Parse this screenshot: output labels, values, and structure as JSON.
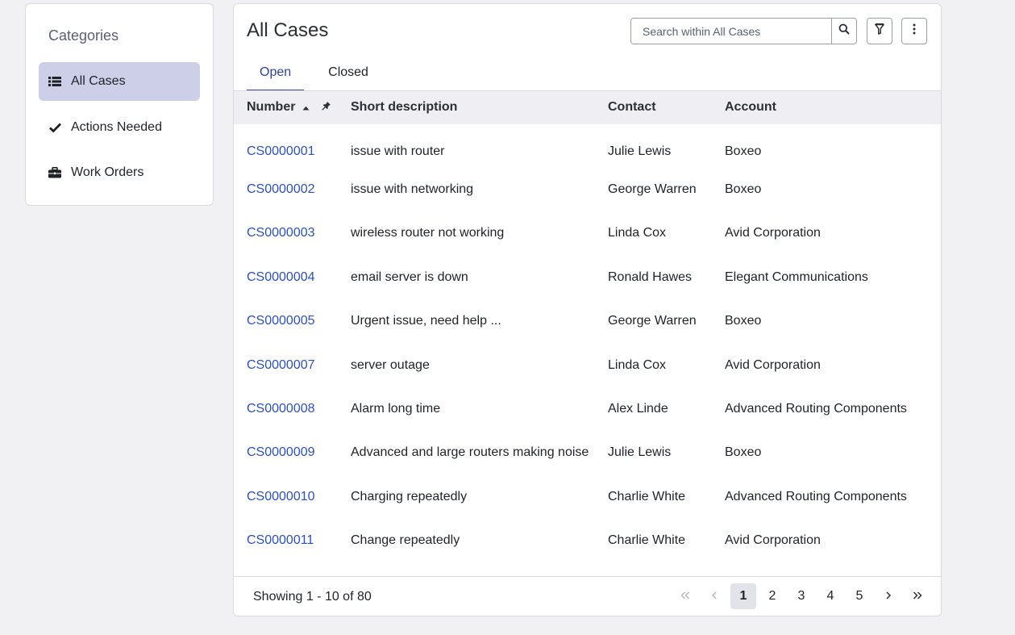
{
  "sidebar": {
    "title": "Categories",
    "items": [
      {
        "label": "All Cases",
        "icon": "list-icon",
        "active": true
      },
      {
        "label": "Actions Needed",
        "icon": "checkmark-icon",
        "active": false
      },
      {
        "label": "Work Orders",
        "icon": "briefcase-icon",
        "active": false
      }
    ]
  },
  "main": {
    "title": "All Cases",
    "search_placeholder": "Search within All Cases",
    "tabs": [
      {
        "label": "Open",
        "active": true
      },
      {
        "label": "Closed",
        "active": false
      }
    ],
    "columns": {
      "number": "Number",
      "short_description": "Short description",
      "contact": "Contact",
      "account": "Account"
    },
    "sort": {
      "column": "Number",
      "direction": "ascending"
    },
    "rows": [
      {
        "number": "CS0000001",
        "desc": "issue with router",
        "contact": "Julie Lewis",
        "account": "Boxeo"
      },
      {
        "number": "CS0000002",
        "desc": "issue with networking",
        "contact": "George Warren",
        "account": "Boxeo"
      },
      {
        "number": "CS0000003",
        "desc": "wireless router not working",
        "contact": "Linda Cox",
        "account": "Avid Corporation"
      },
      {
        "number": "CS0000004",
        "desc": "email server is down",
        "contact": "Ronald Hawes",
        "account": "Elegant Communications"
      },
      {
        "number": "CS0000005",
        "desc": "Urgent issue, need help ...",
        "contact": "George Warren",
        "account": "Boxeo"
      },
      {
        "number": "CS0000007",
        "desc": "server outage",
        "contact": "Linda Cox",
        "account": "Avid Corporation"
      },
      {
        "number": "CS0000008",
        "desc": "Alarm long time",
        "contact": "Alex Linde",
        "account": "Advanced Routing Components"
      },
      {
        "number": "CS0000009",
        "desc": "Advanced and large routers making noise",
        "contact": "Julie Lewis",
        "account": "Boxeo"
      },
      {
        "number": "CS0000010",
        "desc": "Charging repeatedly",
        "contact": "Charlie White",
        "account": "Advanced Routing Components"
      },
      {
        "number": "CS0000011",
        "desc": "Change repeatedly",
        "contact": "Charlie White",
        "account": "Avid Corporation"
      }
    ],
    "footer": {
      "showing": "Showing 1 - 10 of 80",
      "pages": [
        "1",
        "2",
        "3",
        "4",
        "5"
      ],
      "current_page": "1"
    }
  },
  "colors": {
    "accent": "#3b4ab0",
    "link": "#2a50c8",
    "active_sidebar_bg": "#cdcfe8"
  }
}
